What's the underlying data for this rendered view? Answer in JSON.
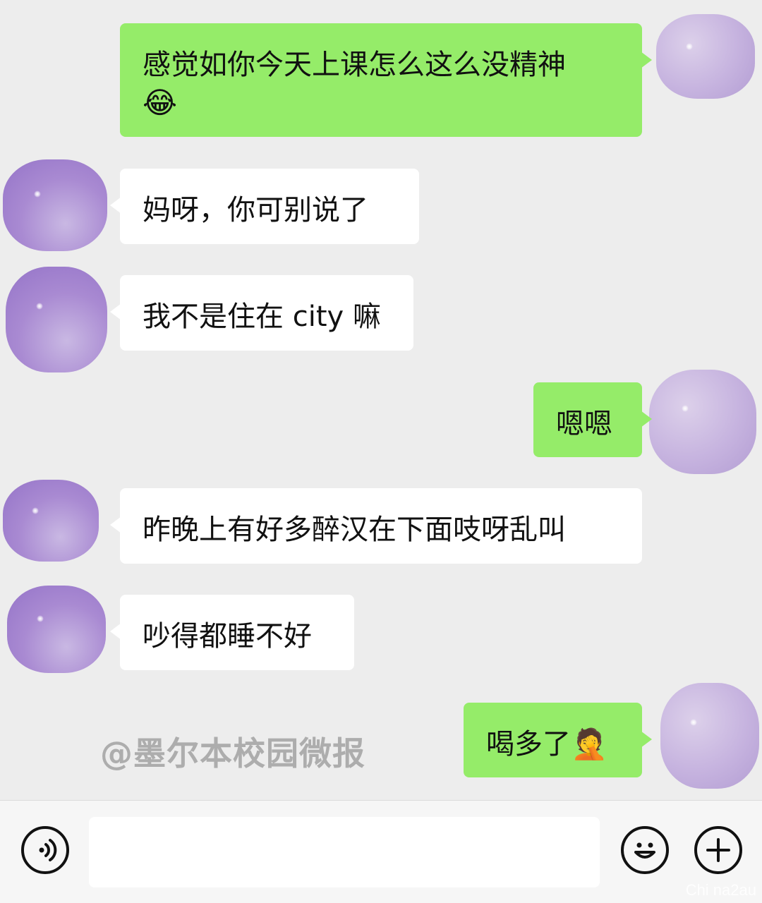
{
  "messages": [
    {
      "direction": "out",
      "text": "感觉如你今天上课怎么这么没精神",
      "emoji": "😂"
    },
    {
      "direction": "in",
      "text": "妈呀，你可别说了"
    },
    {
      "direction": "in",
      "text": "我不是住在 city 嘛"
    },
    {
      "direction": "out",
      "text": "嗯嗯"
    },
    {
      "direction": "in",
      "text": "昨晚上有好多醉汉在下面吱呀乱叫"
    },
    {
      "direction": "in",
      "text": "吵得都睡不好"
    },
    {
      "direction": "out",
      "text": "喝多了",
      "emoji": "🤦"
    }
  ],
  "watermark": "@墨尔本校园微报",
  "corner_watermark": "Chi na2au",
  "input": {
    "value": "",
    "placeholder": ""
  },
  "icons": {
    "voice": "voice-wave-icon",
    "emoji": "smiley-icon",
    "plus": "plus-icon"
  },
  "colors": {
    "chat_background": "#ededed",
    "outgoing_bubble": "#95ec69",
    "incoming_bubble": "#ffffff",
    "input_bar": "#f6f6f6"
  }
}
